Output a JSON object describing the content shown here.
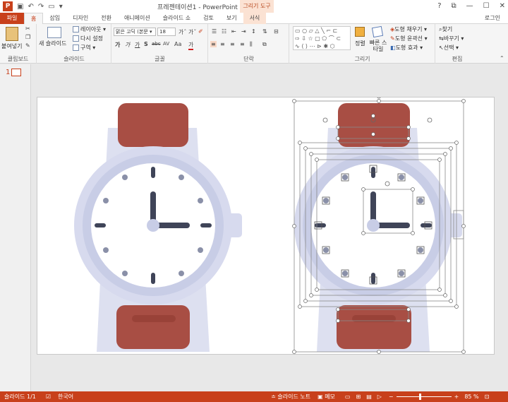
{
  "titlebar": {
    "app_icon_letter": "P",
    "title": "프레젠테이션1 - PowerPoint",
    "contextual_group": "그리기 도구",
    "help": "?",
    "restore": "⧉",
    "minimize": "—",
    "maximize": "☐",
    "close": "✕"
  },
  "tabs": {
    "file": "파일",
    "home": "홈",
    "insert": "삽입",
    "design": "디자인",
    "transitions": "전환",
    "animations": "애니메이션",
    "slideshow": "슬라이드 쇼",
    "review": "검토",
    "view": "보기",
    "format": "서식",
    "login": "로그인"
  },
  "ribbon": {
    "clipboard": {
      "label": "클립보드",
      "paste": "붙여넣기"
    },
    "slides": {
      "label": "슬라이드",
      "new_slide": "새 슬라이드",
      "layout": "레이아웃 ▾",
      "reset": "다시 설정",
      "section": "구역 ▾"
    },
    "font": {
      "label": "글꼴",
      "font_name": "맑은 고딕 (본문 ▾",
      "font_size": "18",
      "bold": "가",
      "italic": "가",
      "underline": "가",
      "shadow": "S",
      "strike": "abc",
      "spacing": "AV",
      "case": "Aa",
      "color": "가"
    },
    "paragraph": {
      "label": "단락"
    },
    "drawing": {
      "label": "그리기",
      "arrange": "정렬",
      "quick_styles": "빠른 스타일",
      "fill": "도형 채우기 ▾",
      "outline": "도형 윤곽선 ▾",
      "effects": "도형 효과 ▾"
    },
    "editing": {
      "label": "편집",
      "find": "찾기",
      "replace": "바꾸기 ▾",
      "select": "선택 ▾"
    }
  },
  "thumbnails": {
    "slide_number": "1"
  },
  "statusbar": {
    "slide_info": "슬라이드 1/1",
    "language": "한국어",
    "notes": "슬라이드 노트",
    "comments": "메모",
    "zoom": "85 %",
    "zoom_fraction": 0.85
  },
  "colors": {
    "accent": "#c8401b",
    "strap": "#a84e44",
    "strap_stripe": "#994238",
    "case_outer": "#d7daee",
    "case_ring": "#c8cde6",
    "dial": "#ffffff",
    "hands": "#3f4458",
    "dots": "#8a90a8"
  }
}
